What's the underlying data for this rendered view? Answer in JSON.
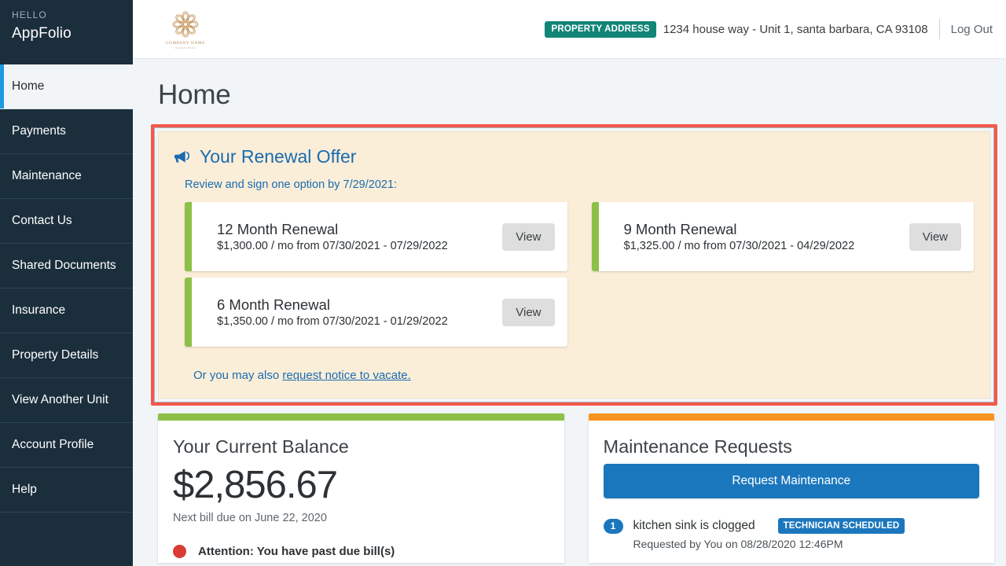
{
  "sidebar": {
    "hello_label": "HELLO",
    "account_name": "AppFolio",
    "items": [
      {
        "label": "Home",
        "active": true
      },
      {
        "label": "Payments",
        "active": false
      },
      {
        "label": "Maintenance",
        "active": false
      },
      {
        "label": "Contact Us",
        "active": false
      },
      {
        "label": "Shared Documents",
        "active": false
      },
      {
        "label": "Insurance",
        "active": false
      },
      {
        "label": "Property Details",
        "active": false
      },
      {
        "label": "View Another Unit",
        "active": false
      },
      {
        "label": "Account Profile",
        "active": false
      },
      {
        "label": "Help",
        "active": false
      }
    ]
  },
  "topbar": {
    "logo": {
      "icon": "flower-mandala-logo-icon",
      "company_name": "COMPANY NAME",
      "tagline": "DESIGN HERE",
      "color": "#c79a63"
    },
    "property_badge_label": "PROPERTY ADDRESS",
    "property_badge_color": "#128576",
    "property_address": "1234 house way - Unit 1, santa barbara, CA 93108",
    "logout_label": "Log Out"
  },
  "page": {
    "title": "Home"
  },
  "renewal": {
    "highlight_color": "#f4584a",
    "icon": "megaphone-icon",
    "title": "Your Renewal Offer",
    "subtitle": "Review and sign one option by 7/29/2021:",
    "accent_color": "#8cc046",
    "offers": [
      {
        "name": "12 Month Renewal",
        "terms": "$1,300.00 / mo from 07/30/2021 - 07/29/2022",
        "button_label": "View"
      },
      {
        "name": "9 Month Renewal",
        "terms": "$1,325.00 / mo from 07/30/2021 - 04/29/2022",
        "button_label": "View"
      },
      {
        "name": "6 Month Renewal",
        "terms": "$1,350.00 / mo from 07/30/2021 - 01/29/2022",
        "button_label": "View"
      }
    ],
    "vacate_prefix": "Or you may also ",
    "vacate_link_label": "request notice to vacate."
  },
  "balance_card": {
    "stripe_color": "#8cc046",
    "title": "Your Current Balance",
    "amount": "$2,856.67",
    "next_bill": "Next bill due on June 22, 2020",
    "alert_dot_color": "#d93b37",
    "alert_text": "Attention: You have past due bill(s)"
  },
  "maintenance_card": {
    "stripe_color": "#f7941d",
    "title": "Maintenance Requests",
    "request_button_label": "Request Maintenance",
    "requests": [
      {
        "number": "1",
        "title": "kitchen sink is clogged",
        "status": "TECHNICIAN SCHEDULED",
        "meta": "Requested by You on 08/28/2020 12:46PM"
      }
    ]
  }
}
